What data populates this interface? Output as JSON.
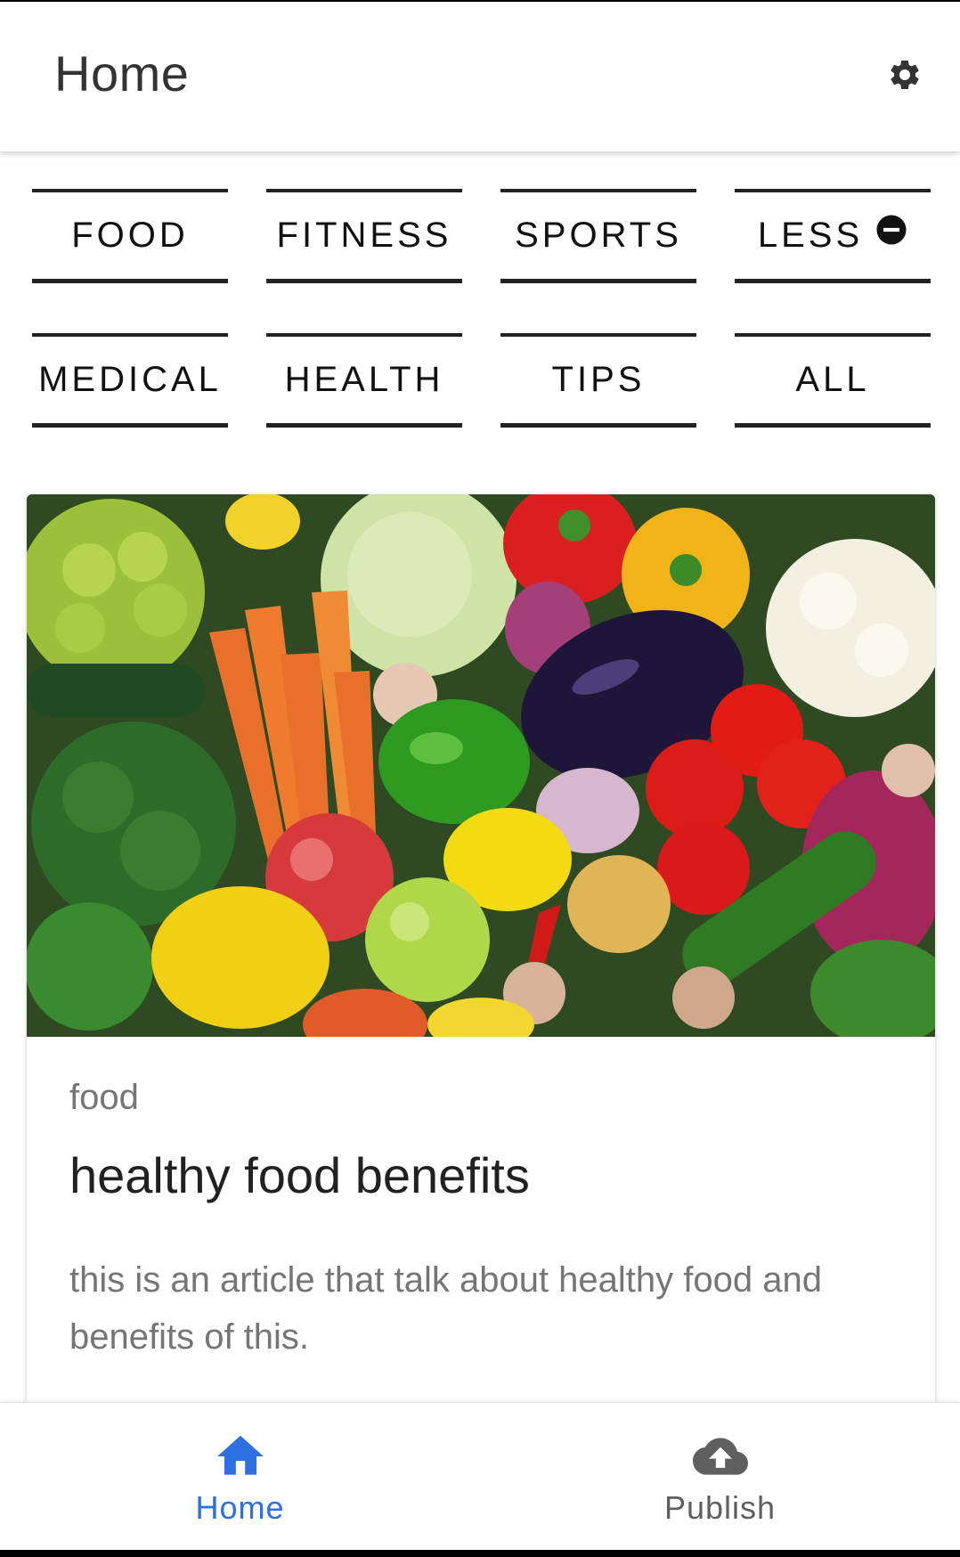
{
  "app_bar": {
    "title": "Home",
    "settings_icon": "gear-icon"
  },
  "categories": {
    "row1": [
      "FOOD",
      "FITNESS",
      "SPORTS"
    ],
    "less_label": "LESS",
    "less_icon": "minus-circle-icon",
    "row2": [
      "MEDICAL",
      "HEALTH",
      "TIPS",
      "ALL"
    ]
  },
  "article": {
    "category": "food",
    "title": "healthy food benefits",
    "description": "this is an article that talk about healthy food and benefits of this."
  },
  "bottom_nav": {
    "items": [
      {
        "label": "Home",
        "icon": "home-icon",
        "active": true
      },
      {
        "label": "Publish",
        "icon": "cloud-upload-icon",
        "active": false
      }
    ],
    "active_color": "#2f6fe4",
    "inactive_color": "#5f5f5f"
  }
}
